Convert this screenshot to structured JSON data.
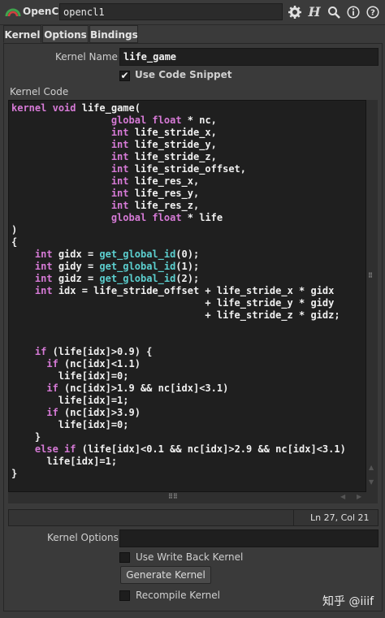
{
  "header": {
    "node_type": "OpenCL",
    "node_name": "opencl1",
    "icons": [
      "gear-icon",
      "houdini-h-icon",
      "search-icon",
      "info-icon",
      "help-icon"
    ]
  },
  "tabs": [
    "Kernel",
    "Options",
    "Bindings"
  ],
  "kernel_name": {
    "label": "Kernel Name",
    "value": "life_game"
  },
  "use_code_snippet": {
    "label": "Use Code Snippet",
    "checked": true
  },
  "kernel_code": {
    "label": "Kernel Code",
    "lines": [
      "kernel void life_game(",
      "                 global float * nc,",
      "                 int life_stride_x,",
      "                 int life_stride_y,",
      "                 int life_stride_z,",
      "                 int life_stride_offset,",
      "                 int life_res_x,",
      "                 int life_res_y,",
      "                 int life_res_z,",
      "                 global float * life",
      ")",
      "{",
      "    int gidx = get_global_id(0);",
      "    int gidy = get_global_id(1);",
      "    int gidz = get_global_id(2);",
      "    int idx = life_stride_offset + life_stride_x * gidx",
      "                                 + life_stride_y * gidy",
      "                                 + life_stride_z * gidz;",
      "",
      "",
      "    if (life[idx]>0.9) {",
      "      if (nc[idx]<1.1)",
      "        life[idx]=0;",
      "      if (nc[idx]>1.9 && nc[idx]<3.1)",
      "        life[idx]=1;",
      "      if (nc[idx]>3.9)",
      "        life[idx]=0;",
      "    }",
      "    else if (life[idx]<0.1 && nc[idx]>2.9 && nc[idx]<3.1)",
      "      life[idx]=1;",
      "}"
    ]
  },
  "status": {
    "cursor": "Ln 27, Col 21"
  },
  "kernel_options": {
    "label": "Kernel Options",
    "value": ""
  },
  "use_write_back_kernel": {
    "label": "Use Write Back Kernel",
    "checked": false
  },
  "generate_kernel": {
    "label": "Generate Kernel"
  },
  "recompile_kernel": {
    "label": "Recompile Kernel",
    "checked": false
  },
  "watermark": "知乎 @iiif"
}
